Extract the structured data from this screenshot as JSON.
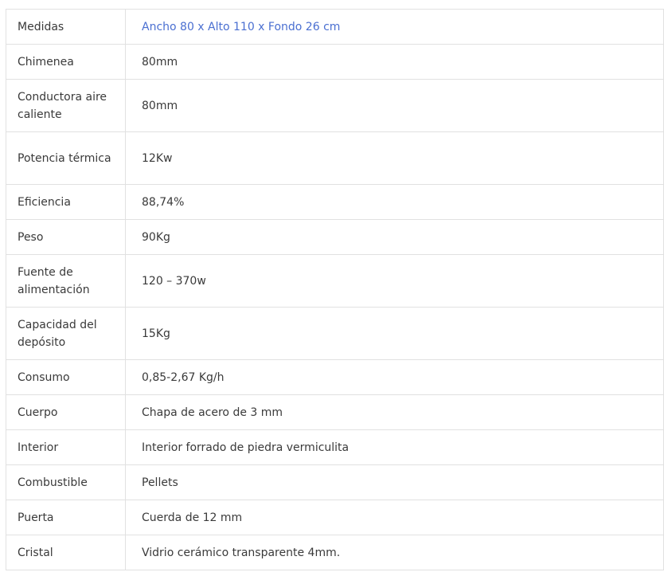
{
  "specs": [
    {
      "label": "Medidas",
      "value": "Ancho 80 x Alto 110 x Fondo 26 cm",
      "highlight": true
    },
    {
      "label": "Chimenea",
      "value": "80mm"
    },
    {
      "label": "Conductora aire caliente",
      "value": "80mm"
    },
    {
      "label": "Potencia térmica",
      "value": "12Kw"
    },
    {
      "label": "Eficiencia",
      "value": "88,74%"
    },
    {
      "label": "Peso",
      "value": "90Kg"
    },
    {
      "label": "Fuente de alimentación",
      "value": "120 – 370w"
    },
    {
      "label": "Capacidad del depósito",
      "value": "15Kg"
    },
    {
      "label": "Consumo",
      "value": "0,85-2,67 Kg/h"
    },
    {
      "label": "Cuerpo",
      "value": "Chapa de acero de 3 mm"
    },
    {
      "label": "Interior",
      "value": "Interior forrado de piedra vermiculita"
    },
    {
      "label": "Combustible",
      "value": "Pellets"
    },
    {
      "label": "Puerta",
      "value": "Cuerda de 12 mm"
    },
    {
      "label": "Cristal",
      "value": "Vidrio cerámico transparente 4mm."
    }
  ],
  "colors": {
    "text": "#3a3a3a",
    "highlight": "#4a6fd1",
    "border": "#e1e1e1"
  }
}
